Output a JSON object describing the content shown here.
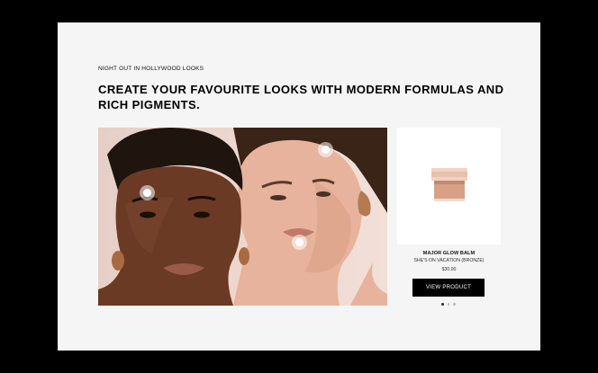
{
  "section": {
    "eyebrow": "NIGHT OUT IN HOLLYWOOD LOOKS",
    "headline": "CREATE YOUR FAVOURITE LOOKS WITH MODERN FORMULAS AND RICH PIGMENTS."
  },
  "hero": {
    "hotspot_count": 3,
    "colors": {
      "background": "#ecd6cf",
      "skin_left": "#6b3a24",
      "skin_right": "#e7b39c",
      "hair": "#2a1a12"
    }
  },
  "product": {
    "name": "MAJOR GLOW BALM",
    "shade": "SHE'S ON VACATION (BRONZE)",
    "price": "$30.00",
    "button_label": "VIEW PRODUCT"
  },
  "carousel": {
    "total": 3,
    "active_index": 0
  }
}
